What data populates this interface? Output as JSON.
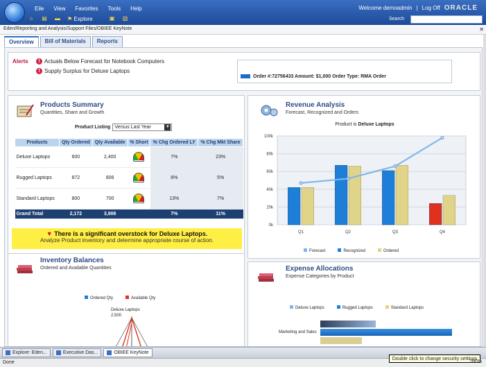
{
  "menu": [
    "Eile",
    "View",
    "Favorites",
    "Tools",
    "Help"
  ],
  "toolbar": {
    "explore_label": "Explore"
  },
  "header": {
    "welcome": "Welcome demoadmin",
    "logoff": "Log Off",
    "brand": "ORACLE",
    "search_label": "Search"
  },
  "breadcrumb": "Eden/Reporting and Analysis/Support Files/OBIEE KeyNote",
  "tabs": [
    "Overview",
    "Bill of Materials",
    "Reports"
  ],
  "alerts": {
    "label": "Alerts",
    "items": [
      "Actuals Below Forecast for Notebook Computers",
      "Supply Surplus for Deluxe Laptops"
    ],
    "order_text": "Order #:72756433 Amount: $1,000 Order Type: RMA Order"
  },
  "products_summary": {
    "title": "Products Summary",
    "subtitle": "Quantities, Share and Growth",
    "listing_label": "Product Listing",
    "listing_value": "Versus Last Year",
    "headers": [
      "Products",
      "Qty Ordered",
      "Qty Available",
      "% Short",
      "% Chg Ordered LY",
      "% Chg Mkt Share"
    ],
    "rows": [
      {
        "product": "Deluxe Laptops",
        "ordered": "600",
        "available": "2,400",
        "chg_ly": "7%",
        "chg_share": "23%"
      },
      {
        "product": "Rugged Laptops",
        "ordered": "872",
        "available": "806",
        "chg_ly": "8%",
        "chg_share": "5%"
      },
      {
        "product": "Standard Laptops",
        "ordered": "800",
        "available": "700",
        "chg_ly": "13%",
        "chg_share": "7%"
      }
    ],
    "total": {
      "product": "Grand Total",
      "ordered": "2,172",
      "available": "3,906",
      "chg_ly": "7%",
      "chg_share": "11%"
    }
  },
  "warning": {
    "title": "There is a significant overstock for Deluxe Laptops.",
    "body": "Analyze Product inventory and determine appropriate course of action."
  },
  "inventory": {
    "title": "Inventory Balances",
    "subtitle": "Ordered and Available Quantities",
    "legend": [
      "Ordered Qty",
      "Available Qty"
    ],
    "axis_label": "Deluxe Laptops",
    "tick": "2,500"
  },
  "revenue": {
    "title": "Revenue Analysis",
    "subtitle": "Forecast, Recognized and Orders",
    "chart_title_prefix": "Product is",
    "chart_title_bold": "Deluxe Laptops",
    "legend": [
      "Forecast",
      "Recognized",
      "Ordered"
    ]
  },
  "expense": {
    "title": "Expense Allocations",
    "subtitle": "Expense Categories by Product",
    "legend": [
      "Deluxe Laptops",
      "Rugged Laptops",
      "Standard Laptops"
    ],
    "row_label": "Marketing and Sales"
  },
  "taskbar": [
    "Explore: Eden...",
    "Executive Das...",
    "OBIEE KeyNote"
  ],
  "status": {
    "left": "Done",
    "tooltip": "Double click to change security settings",
    "trusted": "Trusted sites",
    "zoom": "100%"
  },
  "colors": {
    "forecast": "#7fb6ea",
    "recognized": "#1e7fd8",
    "ordered": "#e0d38a",
    "q4_recognized": "#e0301e",
    "alert": "#c0163b",
    "header_blue": "#1d4a98"
  },
  "chart_data": [
    {
      "type": "bar",
      "title": "Product is Deluxe Laptops",
      "categories": [
        "Q1",
        "Q2",
        "Q3",
        "Q4"
      ],
      "ylim": [
        0,
        100
      ],
      "yticks": [
        "0k",
        "20k",
        "40k",
        "60k",
        "80k",
        "100k"
      ],
      "series": [
        {
          "name": "Forecast",
          "kind": "line",
          "values": [
            47,
            52,
            66,
            98
          ]
        },
        {
          "name": "Recognized",
          "kind": "bar",
          "values": [
            42,
            67,
            61,
            24
          ]
        },
        {
          "name": "Ordered",
          "kind": "bar",
          "values": [
            42,
            66,
            67,
            33
          ]
        }
      ]
    }
  ]
}
